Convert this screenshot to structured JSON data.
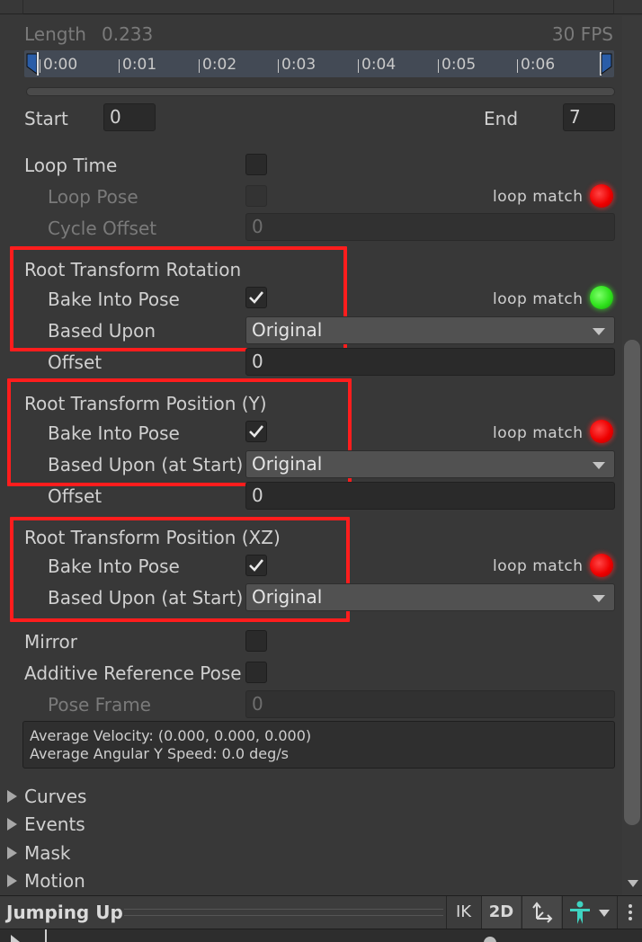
{
  "header": {
    "length_label": "Length",
    "length_value": "0.233",
    "fps": "30 FPS"
  },
  "timeline": {
    "ticks": [
      "0:00",
      "0:01",
      "0:02",
      "0:03",
      "0:04",
      "0:05",
      "0:06"
    ]
  },
  "range": {
    "start_label": "Start",
    "start_value": "0",
    "end_label": "End",
    "end_value": "7"
  },
  "loop": {
    "loop_time_label": "Loop Time",
    "loop_time_checked": false,
    "loop_pose_label": "Loop Pose",
    "loop_pose_checked": false,
    "loop_match_label": "loop match",
    "loop_match_status": "red",
    "cycle_offset_label": "Cycle Offset",
    "cycle_offset_value": "0"
  },
  "root_rotation": {
    "title": "Root Transform Rotation",
    "bake_label": "Bake Into Pose",
    "bake_checked": true,
    "loop_match_label": "loop match",
    "loop_match_status": "green",
    "based_upon_label": "Based Upon",
    "based_upon_value": "Original",
    "offset_label": "Offset",
    "offset_value": "0"
  },
  "root_position_y": {
    "title": "Root Transform Position (Y)",
    "bake_label": "Bake Into Pose",
    "bake_checked": true,
    "loop_match_label": "loop match",
    "loop_match_status": "red",
    "based_upon_label": "Based Upon (at Start)",
    "based_upon_value": "Original",
    "offset_label": "Offset",
    "offset_value": "0"
  },
  "root_position_xz": {
    "title": "Root Transform Position (XZ)",
    "bake_label": "Bake Into Pose",
    "bake_checked": true,
    "loop_match_label": "loop match",
    "loop_match_status": "red",
    "based_upon_label": "Based Upon (at Start)",
    "based_upon_value": "Original"
  },
  "misc": {
    "mirror_label": "Mirror",
    "mirror_checked": false,
    "additive_label": "Additive Reference Pose",
    "additive_checked": false,
    "pose_frame_label": "Pose Frame",
    "pose_frame_value": "0"
  },
  "stats": {
    "velocity": "Average Velocity: (0.000, 0.000, 0.000)",
    "angular": "Average Angular Y Speed: 0.0 deg/s"
  },
  "foldouts": [
    "Curves",
    "Events",
    "Mask",
    "Motion"
  ],
  "preview_bar": {
    "title": "Jumping Up",
    "ik_label": "IK",
    "twod_label": "2D",
    "pivot_icon": "pivot-icon",
    "avatar_icon": "avatar-icon"
  },
  "colors": {
    "red_led": "#ff1a1a",
    "green_led": "#33e21f",
    "highlight_box": "#ff1d1d",
    "avatar_icon": "#3fd3c1"
  }
}
